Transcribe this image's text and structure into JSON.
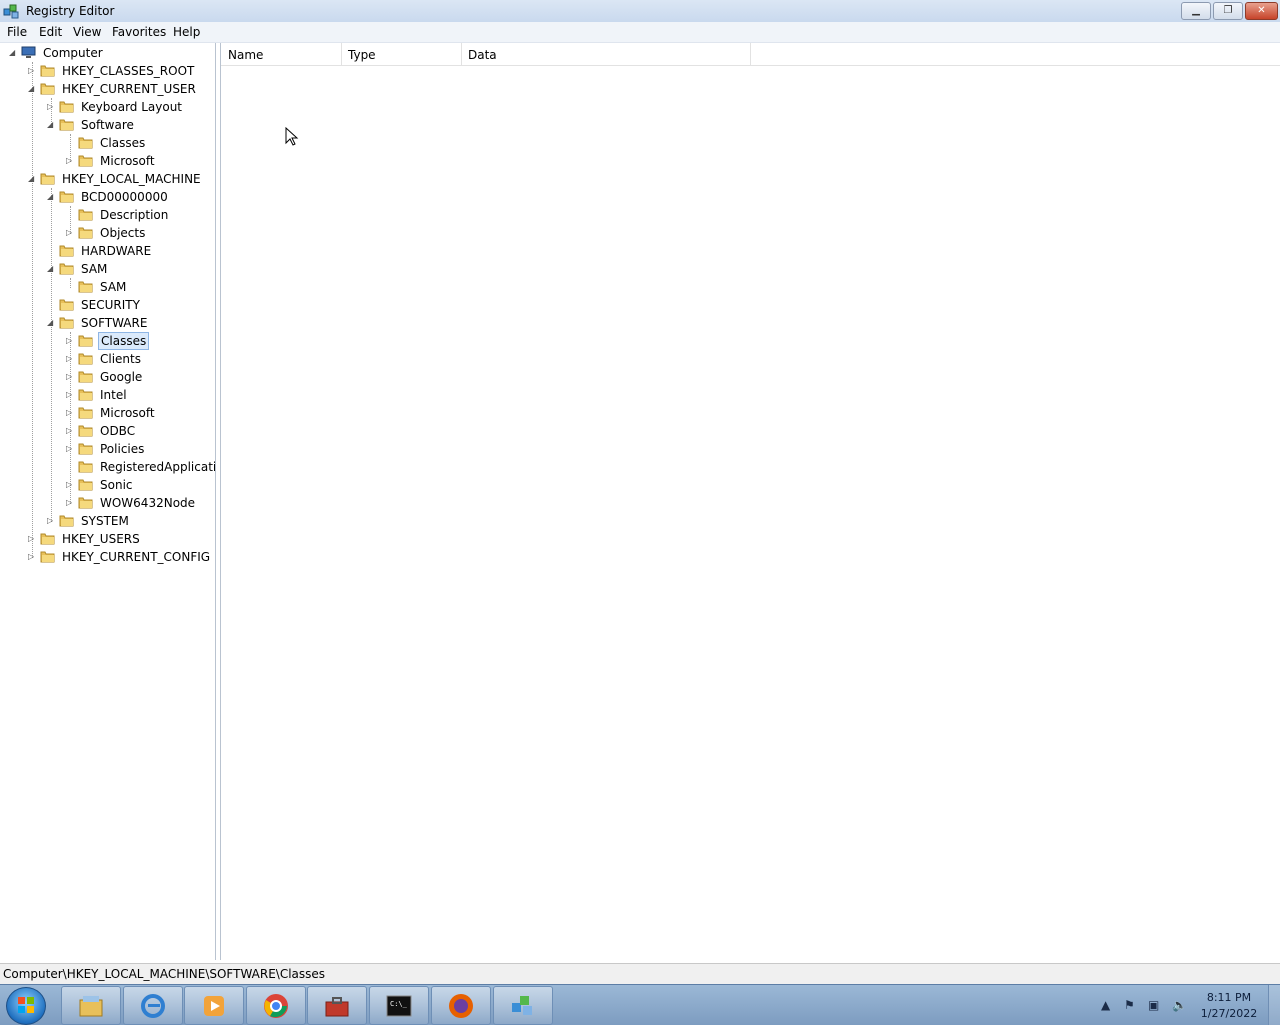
{
  "window": {
    "title": "Registry Editor"
  },
  "menu": [
    "File",
    "Edit",
    "View",
    "Favorites",
    "Help"
  ],
  "tree": [
    {
      "label": "Computer",
      "depth": 0,
      "expander": "open",
      "icon": "computer-icon"
    },
    {
      "label": "HKEY_CLASSES_ROOT",
      "depth": 1,
      "expander": "closed"
    },
    {
      "label": "HKEY_CURRENT_USER",
      "depth": 1,
      "expander": "open"
    },
    {
      "label": "Keyboard Layout",
      "depth": 2,
      "expander": "closed"
    },
    {
      "label": "Software",
      "depth": 2,
      "expander": "open"
    },
    {
      "label": "Classes",
      "depth": 3,
      "expander": "none"
    },
    {
      "label": "Microsoft",
      "depth": 3,
      "expander": "closed"
    },
    {
      "label": "HKEY_LOCAL_MACHINE",
      "depth": 1,
      "expander": "open"
    },
    {
      "label": "BCD00000000",
      "depth": 2,
      "expander": "open"
    },
    {
      "label": "Description",
      "depth": 3,
      "expander": "none"
    },
    {
      "label": "Objects",
      "depth": 3,
      "expander": "closed"
    },
    {
      "label": "HARDWARE",
      "depth": 2,
      "expander": "none"
    },
    {
      "label": "SAM",
      "depth": 2,
      "expander": "open"
    },
    {
      "label": "SAM",
      "depth": 3,
      "expander": "none"
    },
    {
      "label": "SECURITY",
      "depth": 2,
      "expander": "none"
    },
    {
      "label": "SOFTWARE",
      "depth": 2,
      "expander": "open"
    },
    {
      "label": "Classes",
      "depth": 3,
      "expander": "closed",
      "selected": true
    },
    {
      "label": "Clients",
      "depth": 3,
      "expander": "closed"
    },
    {
      "label": "Google",
      "depth": 3,
      "expander": "closed"
    },
    {
      "label": "Intel",
      "depth": 3,
      "expander": "closed"
    },
    {
      "label": "Microsoft",
      "depth": 3,
      "expander": "closed"
    },
    {
      "label": "ODBC",
      "depth": 3,
      "expander": "closed"
    },
    {
      "label": "Policies",
      "depth": 3,
      "expander": "closed"
    },
    {
      "label": "RegisteredApplications",
      "depth": 3,
      "expander": "none"
    },
    {
      "label": "Sonic",
      "depth": 3,
      "expander": "closed"
    },
    {
      "label": "WOW6432Node",
      "depth": 3,
      "expander": "closed"
    },
    {
      "label": "SYSTEM",
      "depth": 2,
      "expander": "closed"
    },
    {
      "label": "HKEY_USERS",
      "depth": 1,
      "expander": "closed"
    },
    {
      "label": "HKEY_CURRENT_CONFIG",
      "depth": 1,
      "expander": "closed"
    }
  ],
  "list": {
    "columns": [
      "Name",
      "Type",
      "Data"
    ]
  },
  "statusbar": {
    "path": "Computer\\HKEY_LOCAL_MACHINE\\SOFTWARE\\Classes"
  },
  "taskbar": {
    "apps": [
      "explorer-icon",
      "internet-explorer-icon",
      "media-player-icon",
      "chrome-icon",
      "toolbox-icon",
      "command-prompt-icon",
      "firefox-icon",
      "registry-editor-icon"
    ],
    "clock": {
      "time": "8:11 PM",
      "date": "1/27/2022"
    }
  },
  "colors": {
    "folder": "#e8c05a",
    "selection": "#dbeafb",
    "taskbar": "#8aa8ca"
  }
}
